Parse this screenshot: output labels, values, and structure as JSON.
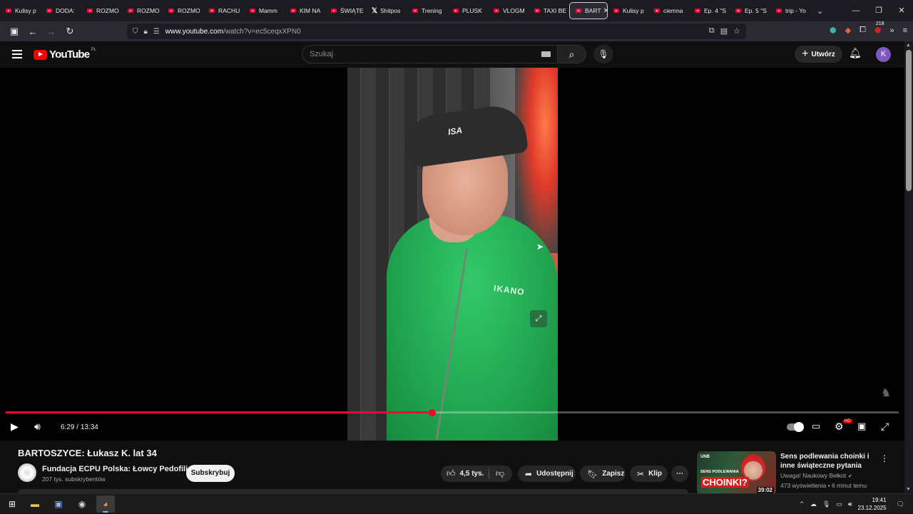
{
  "browser": {
    "tabs": [
      {
        "label": "Kulisy p",
        "icon": "youtube-icon"
      },
      {
        "label": "DODA:",
        "icon": "youtube-icon"
      },
      {
        "label": "ROZMO",
        "icon": "youtube-icon"
      },
      {
        "label": "ROZMO",
        "icon": "youtube-icon"
      },
      {
        "label": "ROZMO",
        "icon": "youtube-icon"
      },
      {
        "label": "RACHU",
        "icon": "youtube-icon"
      },
      {
        "label": "Mamm",
        "icon": "youtube-icon"
      },
      {
        "label": "KIM NA",
        "icon": "youtube-icon"
      },
      {
        "label": "ŚWIĄTE",
        "icon": "youtube-icon"
      },
      {
        "label": "Shitpos",
        "icon": "x-icon"
      },
      {
        "label": "Trening",
        "icon": "youtube-icon"
      },
      {
        "label": "PLUSK",
        "icon": "youtube-icon"
      },
      {
        "label": "VLOGM",
        "icon": "youtube-icon"
      },
      {
        "label": "TAXI BE",
        "icon": "youtube-icon"
      },
      {
        "label": "BART",
        "icon": "youtube-icon",
        "active": true
      },
      {
        "label": "Kulisy p",
        "icon": "youtube-icon"
      },
      {
        "label": "ciemna",
        "icon": "youtube-icon"
      },
      {
        "label": "Ep. 4 \"S",
        "icon": "youtube-icon"
      },
      {
        "label": "Ep. 5 \"S",
        "icon": "youtube-icon"
      },
      {
        "label": "trip - Yo",
        "icon": "youtube-icon"
      }
    ],
    "url_host": "www.youtube.com",
    "url_path": "/watch?v=ec5ceqxXPN0",
    "ext_badge": "218"
  },
  "youtube": {
    "logo_text": "YouTube",
    "logo_country": "PL",
    "search_placeholder": "Szukaj",
    "create_label": "Utwórz",
    "avatar_letter": "K",
    "accent": "#ff0033"
  },
  "player": {
    "current_time": "6:29",
    "duration": "13:34",
    "progress_fraction": 0.478,
    "jacket_text": "IKANO",
    "cap_text": "ISA"
  },
  "video": {
    "title": "BARTOSZYCE: Łukasz K. lat 34",
    "channel_name": "Fundacja ECPU Polska: Łowcy Pedofili",
    "subscribers": "207 tys. subskrybentów",
    "subscribe_label": "Subskrybuj",
    "likes": "4,5 tys.",
    "share_label": "Udostępnij",
    "save_label": "Zapisz",
    "clip_label": "Klip"
  },
  "recommendation": {
    "title": "Sens podlewania choinki i inne świąteczne pytania",
    "channel": "Uwaga! Naukowy Bełkot",
    "meta": "473 wyświetlenia • 6 minut temu",
    "duration": "39:02",
    "thumb_top": "UNB",
    "thumb_line1": "SENS PODLEWANIA",
    "thumb_line2": "CHOINKI?"
  },
  "taskbar": {
    "time": "19:41",
    "date": "23.12.2025"
  }
}
